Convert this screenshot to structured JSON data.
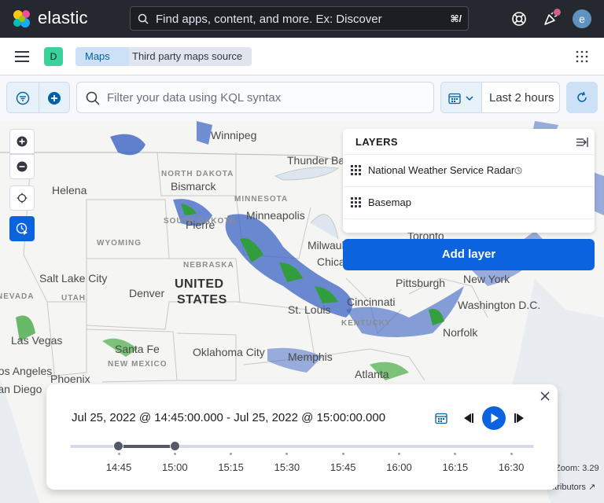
{
  "topbar": {
    "brand": "elastic",
    "search_placeholder": "Find apps, content, and more. Ex: Discover",
    "search_shortcut": "⌘/",
    "avatar_letter": "e"
  },
  "navbar": {
    "space_letter": "D",
    "breadcrumbs": [
      "Maps",
      "Third party maps source"
    ]
  },
  "query": {
    "placeholder": "Filter your data using KQL syntax",
    "date_label": "Last 2 hours"
  },
  "map": {
    "cities": [
      "Winnipeg",
      "Thunder Bay",
      "Helena",
      "Bismarck",
      "Minneapolis",
      "Pierre",
      "Milwaukee",
      "Chicago",
      "Toronto",
      "Salt Lake City",
      "Denver",
      "Pittsburgh",
      "New York",
      "Cincinnati",
      "Washington D.C.",
      "St. Louis",
      "Santa Fe",
      "Oklahoma City",
      "Memphis",
      "Norfolk",
      "Phoenix",
      "Atlanta",
      "Los Angeles",
      "San Diego",
      "Las Vegas"
    ],
    "states": [
      "NORTH DAKOTA",
      "MINNESOTA",
      "SOUTH DAKOTA",
      "WYOMING",
      "NEBRASKA",
      "UTAH",
      "NEVADA",
      "NEW MEXICO",
      "KENTUCKY"
    ],
    "country": [
      "UNITED",
      "STATES"
    ],
    "zoom_label": "Zoom:",
    "zoom_value": "3.29",
    "attribution": "Contributors"
  },
  "layers": {
    "title": "LAYERS",
    "items": [
      {
        "name": "National Weather Service Radar"
      },
      {
        "name": "Basemap"
      }
    ],
    "add_button": "Add layer"
  },
  "timeslider": {
    "range": "Jul 25, 2022 @ 14:45:00.000 - Jul 25, 2022 @ 15:00:00.000",
    "ticks": [
      "14:45",
      "15:00",
      "15:15",
      "15:30",
      "15:45",
      "16:00",
      "16:15",
      "16:30"
    ],
    "selected_start": "14:45",
    "selected_end": "15:00"
  },
  "colors": {
    "topbar": "#25282f",
    "primary": "#0b64dd",
    "radar_blue": "#3b63c4",
    "radar_green": "#2ca02c"
  }
}
